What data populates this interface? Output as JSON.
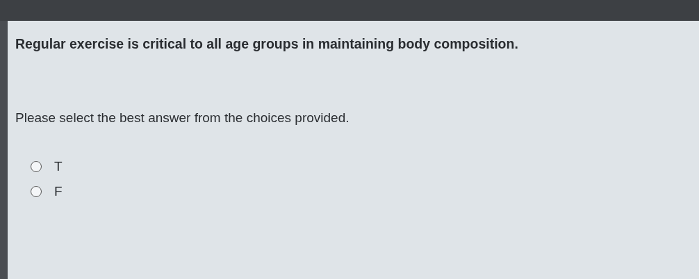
{
  "question": {
    "text": "Regular exercise is critical to all age groups in maintaining body composition.",
    "instruction": "Please select the best answer from the choices provided."
  },
  "choices": [
    {
      "label": "T",
      "selected": false
    },
    {
      "label": "F",
      "selected": false
    }
  ]
}
